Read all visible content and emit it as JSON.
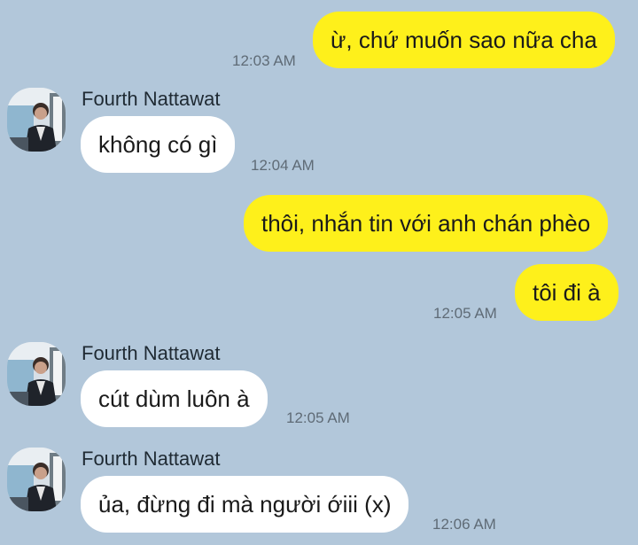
{
  "messages": [
    {
      "side": "sent",
      "text": "ừ, chứ muốn sao nữa cha",
      "time": "12:03 AM"
    },
    {
      "side": "recv",
      "sender": "Fourth Nattawat",
      "text": "không có gì",
      "time": "12:04 AM"
    },
    {
      "side": "sent",
      "text": "thôi, nhắn tin với anh chán phèo",
      "time": ""
    },
    {
      "side": "sent",
      "text": "tôi đi à",
      "time": "12:05 AM"
    },
    {
      "side": "recv",
      "sender": "Fourth Nattawat",
      "text": "cút dùm luôn à",
      "time": "12:05 AM"
    },
    {
      "side": "recv",
      "sender": "Fourth Nattawat",
      "text": "ủa, đừng đi mà người ớiii (x)",
      "time": "12:06 AM"
    }
  ],
  "colors": {
    "background": "#b2c7da",
    "sent_bubble": "#fef01b",
    "received_bubble": "#ffffff"
  }
}
